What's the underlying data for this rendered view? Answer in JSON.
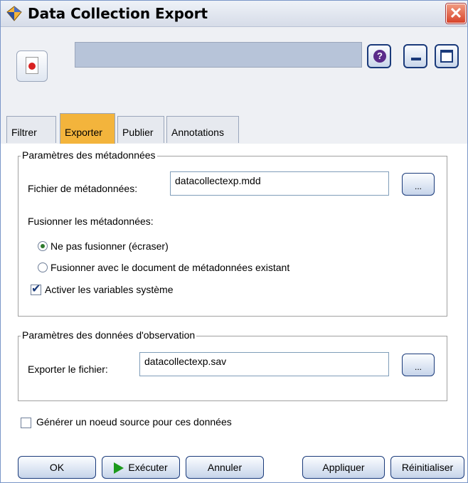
{
  "window": {
    "title": "Data Collection Export",
    "close_glyph": "✕"
  },
  "toolbar": {
    "help_glyph": "?"
  },
  "tabs": [
    {
      "label": "Filtrer"
    },
    {
      "label": "Exporter"
    },
    {
      "label": "Publier"
    },
    {
      "label": "Annotations"
    }
  ],
  "active_tab": "Exporter",
  "metadata_group": {
    "title": "Paramètres des métadonnées",
    "file_label": "Fichier de métadonnées:",
    "file_value": "datacollectexp.mdd",
    "browse_label": "...",
    "merge_label": "Fusionner les métadonnées:",
    "radio_no_merge": "Ne pas fusionner (écraser)",
    "radio_merge": "Fusionner avec le document de métadonnées existant",
    "selected_radio": "no_merge",
    "system_vars_label": "Activer les variables système",
    "system_vars_checked": true
  },
  "case_group": {
    "title": "Paramètres des données d'observation",
    "export_label": "Exporter le fichier:",
    "export_value": "datacollectexp.sav",
    "browse_label": "..."
  },
  "generate_source": {
    "label": "Générer un noeud source pour ces données",
    "checked": false
  },
  "buttons": {
    "ok": "OK",
    "run": "Exécuter",
    "cancel": "Annuler",
    "apply": "Appliquer",
    "reset": "Réinitialiser"
  },
  "colors": {
    "active_tab": "#f3b43c",
    "header_bg": "#eef0f4",
    "name_bar": "#b7c4d9"
  }
}
